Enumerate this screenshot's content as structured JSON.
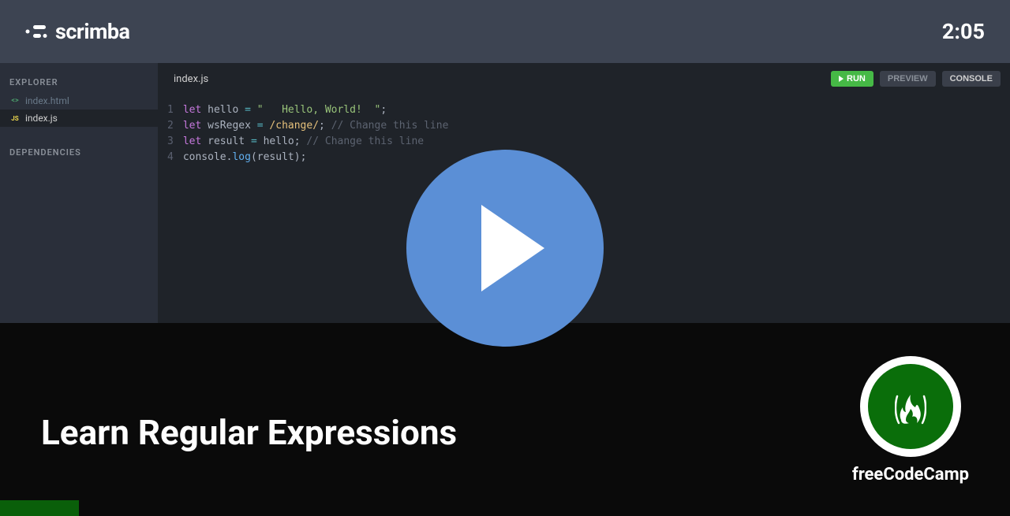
{
  "header": {
    "logo": "scrimba",
    "timestamp": "2:05"
  },
  "sidebar": {
    "explorer_label": "EXPLORER",
    "dependencies_label": "DEPENDENCIES",
    "files": [
      {
        "name": "index.html",
        "type": "html",
        "active": false
      },
      {
        "name": "index.js",
        "type": "js",
        "active": true
      }
    ]
  },
  "editor": {
    "tab_filename": "index.js",
    "actions": {
      "run": "RUN",
      "preview": "PREVIEW",
      "console": "CONSOLE"
    },
    "line_numbers": [
      "1",
      "2",
      "3",
      "4"
    ],
    "code_lines": [
      {
        "tokens": [
          {
            "type": "keyword",
            "text": "let"
          },
          {
            "type": "normal",
            "text": " "
          },
          {
            "type": "normal",
            "text": "hello"
          },
          {
            "type": "normal",
            "text": " "
          },
          {
            "type": "operator",
            "text": "="
          },
          {
            "type": "normal",
            "text": " "
          },
          {
            "type": "string",
            "text": "\"   Hello, World!  \""
          },
          {
            "type": "punctuation",
            "text": ";"
          }
        ]
      },
      {
        "tokens": [
          {
            "type": "keyword",
            "text": "let"
          },
          {
            "type": "normal",
            "text": " "
          },
          {
            "type": "normal",
            "text": "wsRegex"
          },
          {
            "type": "normal",
            "text": " "
          },
          {
            "type": "operator",
            "text": "="
          },
          {
            "type": "normal",
            "text": " "
          },
          {
            "type": "regex",
            "text": "/change/"
          },
          {
            "type": "punctuation",
            "text": ";"
          },
          {
            "type": "normal",
            "text": " "
          },
          {
            "type": "comment",
            "text": "// Change this line"
          }
        ]
      },
      {
        "tokens": [
          {
            "type": "keyword",
            "text": "let"
          },
          {
            "type": "normal",
            "text": " "
          },
          {
            "type": "normal",
            "text": "result"
          },
          {
            "type": "normal",
            "text": " "
          },
          {
            "type": "operator",
            "text": "="
          },
          {
            "type": "normal",
            "text": " "
          },
          {
            "type": "normal",
            "text": "hello"
          },
          {
            "type": "punctuation",
            "text": ";"
          },
          {
            "type": "normal",
            "text": " "
          },
          {
            "type": "comment",
            "text": "// Change this line"
          }
        ]
      },
      {
        "tokens": [
          {
            "type": "normal",
            "text": "console"
          },
          {
            "type": "punctuation",
            "text": "."
          },
          {
            "type": "function",
            "text": "log"
          },
          {
            "type": "punctuation",
            "text": "("
          },
          {
            "type": "normal",
            "text": "result"
          },
          {
            "type": "punctuation",
            "text": ")"
          },
          {
            "type": "punctuation",
            "text": ";"
          }
        ]
      }
    ]
  },
  "console": {
    "label": "CONSOLE"
  },
  "overlay": {
    "course_title": "Learn Regular Expressions",
    "provider": "freeCodeCamp"
  }
}
